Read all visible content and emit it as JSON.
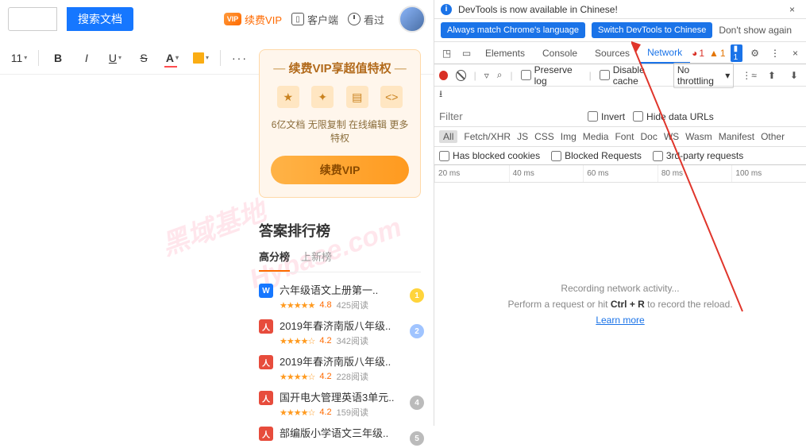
{
  "topbar": {
    "search_btn": "搜索文档",
    "vip_badge": "VIP",
    "vip_label": "续费VIP",
    "client_label": "客户端",
    "recent_label": "看过"
  },
  "editor": {
    "font_size": "11"
  },
  "vip_card": {
    "title": "续费VIP享超值特权",
    "desc": "6亿文档  无限复制  在线编辑  更多特权",
    "button": "续费VIP"
  },
  "rank": {
    "title": "答案排行榜",
    "tab_high": "高分榜",
    "tab_new": "上新榜",
    "items": [
      {
        "icon": "W",
        "title": "六年级语文上册第一..",
        "stars": "★★★★★",
        "score": "4.8",
        "reads": "425阅读",
        "badge": "1"
      },
      {
        "icon": "人",
        "title": "2019年春济南版八年级..",
        "stars": "★★★★☆",
        "score": "4.2",
        "reads": "342阅读",
        "badge": "2"
      },
      {
        "icon": "人",
        "title": "2019年春济南版八年级..",
        "stars": "★★★★☆",
        "score": "4.2",
        "reads": "228阅读",
        "badge": ""
      },
      {
        "icon": "人",
        "title": "国开电大管理英语3单元..",
        "stars": "★★★★☆",
        "score": "4.2",
        "reads": "159阅读",
        "badge": "4"
      },
      {
        "icon": "人",
        "title": "部编版小学语文三年级..",
        "stars": "",
        "score": "",
        "reads": "",
        "badge": "5"
      }
    ]
  },
  "devtools": {
    "notice": "DevTools is now available in Chinese!",
    "lang_match": "Always match Chrome's language",
    "lang_switch": "Switch DevTools to Chinese",
    "lang_dont": "Don't show again",
    "tabs": {
      "elements": "Elements",
      "console": "Console",
      "sources": "Sources",
      "network": "Network"
    },
    "status": {
      "err": "1",
      "warn": "1",
      "info": "1"
    },
    "row2": {
      "preserve": "Preserve log",
      "disable": "Disable cache",
      "throttle": "No throttling"
    },
    "filter_placeholder": "Filter",
    "invert": "Invert",
    "hide_urls": "Hide data URLs",
    "types": [
      "All",
      "Fetch/XHR",
      "JS",
      "CSS",
      "Img",
      "Media",
      "Font",
      "Doc",
      "WS",
      "Wasm",
      "Manifest",
      "Other"
    ],
    "blocked_cookies": "Has blocked cookies",
    "blocked_req": "Blocked Requests",
    "third_party": "3rd-party requests",
    "timeline": [
      "20 ms",
      "40 ms",
      "60 ms",
      "80 ms",
      "100 ms"
    ],
    "body": {
      "recording": "Recording network activity...",
      "hint_pre": "Perform a request or hit ",
      "hint_key": "Ctrl + R",
      "hint_post": " to record the reload.",
      "learn": "Learn more"
    }
  }
}
